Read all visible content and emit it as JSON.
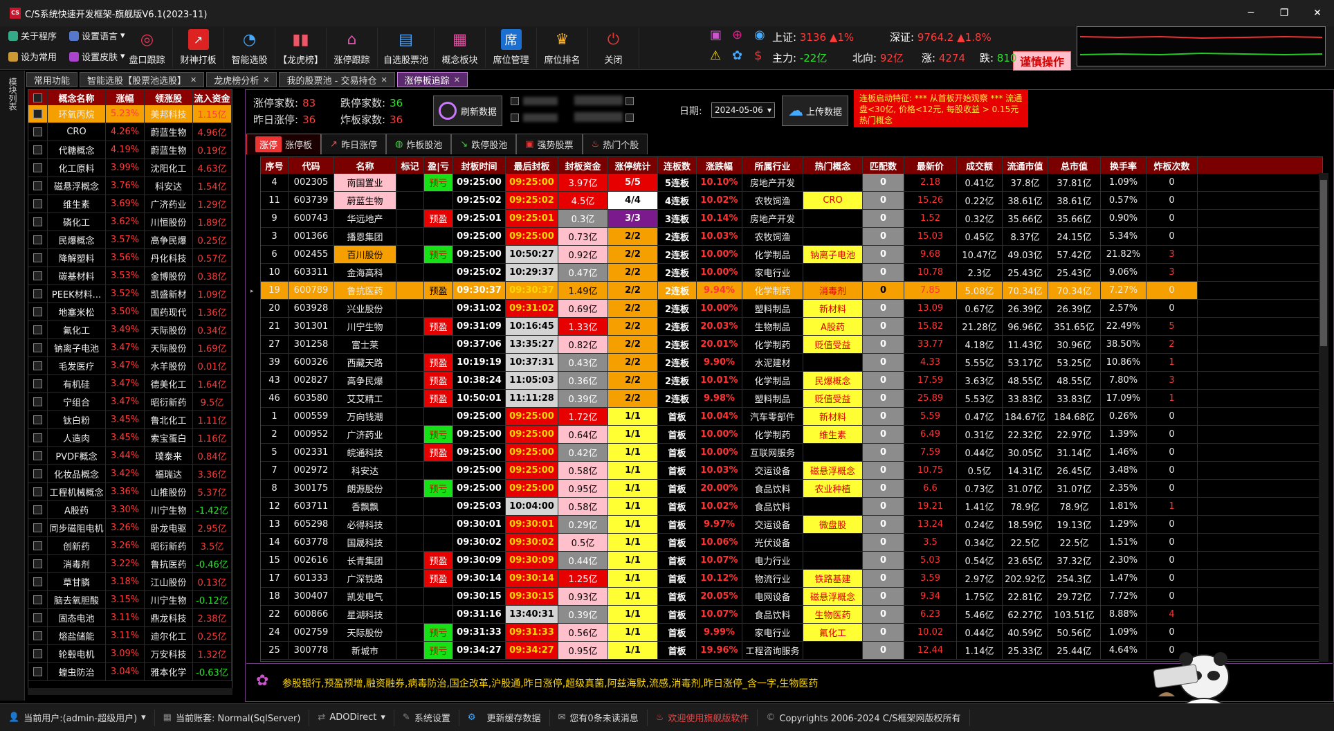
{
  "app": {
    "title": "C/S系统快速开发框架-旗舰版V6.1(2023-11)",
    "logo": "CS"
  },
  "toolbar": {
    "small": [
      "关于程序",
      "设置语言",
      "设为常用",
      "设置皮肤"
    ],
    "buttons": [
      "盘口跟踪",
      "财神打板",
      "智能选股",
      "【龙虎榜】",
      "涨停跟踪",
      "自选股票池",
      "概念板块",
      "席位管理",
      "席位排名",
      "关闭"
    ]
  },
  "market": {
    "sh_label": "上证:",
    "sh_value": "3136",
    "sh_change": "▲1%",
    "sz_label": "深证:",
    "sz_value": "9764.2",
    "sz_change": "▲1.8%",
    "main_label": "主力:",
    "main_value": "-22亿",
    "north_label": "北向:",
    "north_value": "92亿",
    "up_label": "涨:",
    "up_value": "4274",
    "down_label": "跌:",
    "down_value": "810",
    "warn": "谨慎操作"
  },
  "side_label": "模块列表",
  "tabs": [
    {
      "label": "常用功能"
    },
    {
      "label": "智能选股【股票池选股】"
    },
    {
      "label": "龙虎榜分析"
    },
    {
      "label": "我的股票池 - 交易持仓"
    },
    {
      "label": "涨停板追踪"
    }
  ],
  "left": {
    "headers": [
      "概念名称",
      "涨幅",
      "领涨股",
      "流入资金"
    ],
    "rows": [
      [
        "环氧丙烷",
        "5.23%",
        "美邦科技",
        "1.15亿"
      ],
      [
        "CRO",
        "4.26%",
        "蔚蓝生物",
        "4.96亿"
      ],
      [
        "代糖概念",
        "4.19%",
        "蔚蓝生物",
        "0.19亿"
      ],
      [
        "化工原料",
        "3.99%",
        "沈阳化工",
        "4.63亿"
      ],
      [
        "磁悬浮概念",
        "3.76%",
        "科安达",
        "1.54亿"
      ],
      [
        "维生素",
        "3.69%",
        "广济药业",
        "1.29亿"
      ],
      [
        "磷化工",
        "3.62%",
        "川恒股份",
        "1.89亿"
      ],
      [
        "民爆概念",
        "3.57%",
        "高争民爆",
        "0.25亿"
      ],
      [
        "降解塑料",
        "3.56%",
        "丹化科技",
        "0.57亿"
      ],
      [
        "碳基材料",
        "3.53%",
        "金博股份",
        "0.38亿"
      ],
      [
        "PEEK材料...",
        "3.52%",
        "凯盛新材",
        "1.09亿"
      ],
      [
        "地塞米松",
        "3.50%",
        "国药现代",
        "1.36亿"
      ],
      [
        "氟化工",
        "3.49%",
        "天际股份",
        "0.34亿"
      ],
      [
        "钠离子电池",
        "3.47%",
        "天际股份",
        "1.69亿"
      ],
      [
        "毛发医疗",
        "3.47%",
        "水羊股份",
        "0.01亿"
      ],
      [
        "有机硅",
        "3.47%",
        "德美化工",
        "1.64亿"
      ],
      [
        "宁组合",
        "3.47%",
        "昭衍新药",
        "9.5亿"
      ],
      [
        "钛白粉",
        "3.45%",
        "鲁北化工",
        "1.11亿"
      ],
      [
        "人造肉",
        "3.45%",
        "索宝蛋白",
        "1.16亿"
      ],
      [
        "PVDF概念",
        "3.44%",
        "璞泰来",
        "0.84亿"
      ],
      [
        "化妆品概念",
        "3.42%",
        "福瑞达",
        "3.36亿"
      ],
      [
        "工程机械概念",
        "3.36%",
        "山推股份",
        "5.37亿"
      ],
      [
        "A股药",
        "3.30%",
        "川宁生物",
        "-1.42亿"
      ],
      [
        "同步磁阻电机",
        "3.26%",
        "卧龙电驱",
        "2.95亿"
      ],
      [
        "创新药",
        "3.26%",
        "昭衍新药",
        "3.5亿"
      ],
      [
        "消毒剂",
        "3.22%",
        "鲁抗医药",
        "-0.46亿"
      ],
      [
        "草甘膦",
        "3.18%",
        "江山股份",
        "0.13亿"
      ],
      [
        "脑去氧胆酸",
        "3.15%",
        "川宁生物",
        "-0.12亿"
      ],
      [
        "固态电池",
        "3.11%",
        "鼎龙科技",
        "2.38亿"
      ],
      [
        "熔盐储能",
        "3.11%",
        "迪尔化工",
        "0.25亿"
      ],
      [
        "轮毂电机",
        "3.09%",
        "万安科技",
        "1.32亿"
      ],
      [
        "蝗虫防治",
        "3.04%",
        "雅本化学",
        "-0.63亿"
      ]
    ]
  },
  "stats": {
    "up_label": "涨停家数:",
    "up": "83",
    "down_label": "跌停家数:",
    "down": "36",
    "yday_label": "昨日涨停:",
    "yday": "36",
    "broken_label": "炸板家数:",
    "broken": "36"
  },
  "controls": {
    "refresh": "刷新数据",
    "date_label": "日期:",
    "date": "2024-05-06",
    "upload": "上传数据"
  },
  "notice": "连板启动特征: *** 从首板开始观察 *** 流通盘<30亿, 价格<12元, 每股收益 > 0.15元热门概念",
  "subtabs": [
    {
      "badge": "涨停",
      "label": "涨停板"
    },
    {
      "label": "昨日涨停"
    },
    {
      "label": "炸板股池"
    },
    {
      "label": "跌停股池"
    },
    {
      "label": "强势股票"
    },
    {
      "label": "热门个股"
    }
  ],
  "grid": {
    "headers": [
      "序号",
      "代码",
      "名称",
      "标记",
      "盈|亏",
      "封板时间",
      "最后封板",
      "封板资金",
      "涨停统计",
      "连板数",
      "涨跌幅",
      "所属行业",
      "热门概念",
      "匹配数",
      "最新价",
      "成交额",
      "流通市值",
      "总市值",
      "换手率",
      "炸板次数"
    ],
    "rows": [
      [
        "4",
        "002305",
        "南国置业",
        "",
        "预亏",
        "09:25:00",
        "09:25:00",
        "3.97亿",
        "5/5",
        "5连板",
        "10.10%",
        "房地产开发",
        "",
        "0",
        "2.18",
        "0.41亿",
        "37.8亿",
        "37.81亿",
        "1.09%",
        "0"
      ],
      [
        "11",
        "603739",
        "蔚蓝生物",
        "",
        "",
        "09:25:02",
        "09:25:02",
        "4.5亿",
        "4/4",
        "4连板",
        "10.02%",
        "农牧饲渔",
        "CRO",
        "0",
        "15.26",
        "0.22亿",
        "38.61亿",
        "38.61亿",
        "0.57%",
        "0"
      ],
      [
        "9",
        "600743",
        "华远地产",
        "",
        "预盈",
        "09:25:01",
        "09:25:01",
        "0.3亿",
        "3/3",
        "3连板",
        "10.14%",
        "房地产开发",
        "",
        "0",
        "1.52",
        "0.32亿",
        "35.66亿",
        "35.66亿",
        "0.90%",
        "0"
      ],
      [
        "3",
        "001366",
        "播恩集团",
        "",
        "",
        "09:25:00",
        "09:25:00",
        "0.73亿",
        "2/2",
        "2连板",
        "10.03%",
        "农牧饲渔",
        "",
        "0",
        "15.03",
        "0.45亿",
        "8.37亿",
        "24.15亿",
        "5.34%",
        "0"
      ],
      [
        "6",
        "002455",
        "百川股份",
        "",
        "预亏",
        "09:25:00",
        "10:50:27",
        "0.92亿",
        "2/2",
        "2连板",
        "10.00%",
        "化学制品",
        "钠离子电池",
        "0",
        "9.68",
        "10.47亿",
        "49.03亿",
        "57.42亿",
        "21.82%",
        "3"
      ],
      [
        "10",
        "603311",
        "金海高科",
        "",
        "",
        "09:25:02",
        "10:29:37",
        "0.47亿",
        "2/2",
        "2连板",
        "10.00%",
        "家电行业",
        "",
        "0",
        "10.78",
        "2.3亿",
        "25.43亿",
        "25.43亿",
        "9.06%",
        "3"
      ],
      [
        "19",
        "600789",
        "鲁抗医药",
        "",
        "预盈",
        "09:30:37",
        "09:30:37",
        "1.49亿",
        "2/2",
        "2连板",
        "9.94%",
        "化学制药",
        "消毒剂",
        "0",
        "7.85",
        "5.08亿",
        "70.34亿",
        "70.34亿",
        "7.27%",
        "0"
      ],
      [
        "20",
        "603928",
        "兴业股份",
        "",
        "",
        "09:31:02",
        "09:31:02",
        "0.69亿",
        "2/2",
        "2连板",
        "10.00%",
        "塑料制品",
        "新材料",
        "0",
        "13.09",
        "0.67亿",
        "26.39亿",
        "26.39亿",
        "2.57%",
        "0"
      ],
      [
        "21",
        "301301",
        "川宁生物",
        "",
        "预盈",
        "09:31:09",
        "10:16:45",
        "1.33亿",
        "2/2",
        "2连板",
        "20.03%",
        "生物制品",
        "A股药",
        "0",
        "15.82",
        "21.28亿",
        "96.96亿",
        "351.65亿",
        "22.49%",
        "5"
      ],
      [
        "27",
        "301258",
        "富士莱",
        "",
        "",
        "09:37:06",
        "13:35:27",
        "0.82亿",
        "2/2",
        "2连板",
        "20.01%",
        "化学制药",
        "贬值受益",
        "0",
        "33.77",
        "4.18亿",
        "11.43亿",
        "30.96亿",
        "38.50%",
        "2"
      ],
      [
        "39",
        "600326",
        "西藏天路",
        "",
        "预盈",
        "10:19:19",
        "10:37:31",
        "0.43亿",
        "2/2",
        "2连板",
        "9.90%",
        "水泥建材",
        "",
        "0",
        "4.33",
        "5.55亿",
        "53.17亿",
        "53.25亿",
        "10.86%",
        "1"
      ],
      [
        "43",
        "002827",
        "高争民爆",
        "",
        "预盈",
        "10:38:24",
        "11:05:03",
        "0.36亿",
        "2/2",
        "2连板",
        "10.01%",
        "化学制品",
        "民爆概念",
        "0",
        "17.59",
        "3.63亿",
        "48.55亿",
        "48.55亿",
        "7.80%",
        "3"
      ],
      [
        "46",
        "603580",
        "艾艾精工",
        "",
        "预盈",
        "10:50:01",
        "11:11:28",
        "0.39亿",
        "2/2",
        "2连板",
        "9.98%",
        "塑料制品",
        "贬值受益",
        "0",
        "25.89",
        "5.53亿",
        "33.83亿",
        "33.83亿",
        "17.09%",
        "1"
      ],
      [
        "1",
        "000559",
        "万向钱潮",
        "",
        "",
        "09:25:00",
        "09:25:00",
        "1.72亿",
        "1/1",
        "首板",
        "10.04%",
        "汽车零部件",
        "新材料",
        "0",
        "5.59",
        "0.47亿",
        "184.67亿",
        "184.68亿",
        "0.26%",
        "0"
      ],
      [
        "2",
        "000952",
        "广济药业",
        "",
        "预亏",
        "09:25:00",
        "09:25:00",
        "0.64亿",
        "1/1",
        "首板",
        "10.00%",
        "化学制药",
        "维生素",
        "0",
        "6.49",
        "0.31亿",
        "22.32亿",
        "22.97亿",
        "1.39%",
        "0"
      ],
      [
        "5",
        "002331",
        "皖通科技",
        "",
        "预盈",
        "09:25:00",
        "09:25:00",
        "0.42亿",
        "1/1",
        "首板",
        "10.00%",
        "互联网服务",
        "",
        "0",
        "7.59",
        "0.44亿",
        "30.05亿",
        "31.14亿",
        "1.46%",
        "0"
      ],
      [
        "7",
        "002972",
        "科安达",
        "",
        "",
        "09:25:00",
        "09:25:00",
        "0.58亿",
        "1/1",
        "首板",
        "10.03%",
        "交运设备",
        "磁悬浮概念",
        "0",
        "10.75",
        "0.5亿",
        "14.31亿",
        "26.45亿",
        "3.48%",
        "0"
      ],
      [
        "8",
        "300175",
        "朗源股份",
        "",
        "预亏",
        "09:25:00",
        "09:25:00",
        "0.95亿",
        "1/1",
        "首板",
        "20.00%",
        "食品饮料",
        "农业种植",
        "0",
        "6.6",
        "0.73亿",
        "31.07亿",
        "31.07亿",
        "2.35%",
        "0"
      ],
      [
        "12",
        "603711",
        "香飘飘",
        "",
        "",
        "09:25:03",
        "10:04:00",
        "0.58亿",
        "1/1",
        "首板",
        "10.02%",
        "食品饮料",
        "",
        "0",
        "19.21",
        "1.41亿",
        "78.9亿",
        "78.9亿",
        "1.81%",
        "1"
      ],
      [
        "13",
        "605298",
        "必得科技",
        "",
        "",
        "09:30:01",
        "09:30:01",
        "0.29亿",
        "1/1",
        "首板",
        "9.97%",
        "交运设备",
        "微盘股",
        "0",
        "13.24",
        "0.24亿",
        "18.59亿",
        "19.13亿",
        "1.29%",
        "0"
      ],
      [
        "14",
        "603778",
        "国晟科技",
        "",
        "",
        "09:30:02",
        "09:30:02",
        "0.5亿",
        "1/1",
        "首板",
        "10.06%",
        "光伏设备",
        "",
        "0",
        "3.5",
        "0.34亿",
        "22.5亿",
        "22.5亿",
        "1.51%",
        "0"
      ],
      [
        "15",
        "002616",
        "长青集团",
        "",
        "预盈",
        "09:30:09",
        "09:30:09",
        "0.44亿",
        "1/1",
        "首板",
        "10.07%",
        "电力行业",
        "",
        "0",
        "5.03",
        "0.54亿",
        "23.65亿",
        "37.32亿",
        "2.30%",
        "0"
      ],
      [
        "17",
        "601333",
        "广深铁路",
        "",
        "预盈",
        "09:30:14",
        "09:30:14",
        "1.25亿",
        "1/1",
        "首板",
        "10.12%",
        "物流行业",
        "铁路基建",
        "0",
        "3.59",
        "2.97亿",
        "202.92亿",
        "254.3亿",
        "1.47%",
        "0"
      ],
      [
        "18",
        "300407",
        "凯发电气",
        "",
        "",
        "09:30:15",
        "09:30:15",
        "0.93亿",
        "1/1",
        "首板",
        "20.05%",
        "电网设备",
        "磁悬浮概念",
        "0",
        "9.34",
        "1.75亿",
        "22.81亿",
        "29.72亿",
        "7.72%",
        "0"
      ],
      [
        "22",
        "600866",
        "星湖科技",
        "",
        "",
        "09:31:16",
        "13:40:31",
        "0.39亿",
        "1/1",
        "首板",
        "10.07%",
        "食品饮料",
        "生物医药",
        "0",
        "6.23",
        "5.46亿",
        "62.27亿",
        "103.51亿",
        "8.88%",
        "4"
      ],
      [
        "24",
        "002759",
        "天际股份",
        "",
        "预亏",
        "09:31:33",
        "09:31:33",
        "0.56亿",
        "1/1",
        "首板",
        "9.99%",
        "家电行业",
        "氟化工",
        "0",
        "10.02",
        "0.44亿",
        "40.59亿",
        "50.56亿",
        "1.09%",
        "0"
      ],
      [
        "25",
        "300778",
        "新城市",
        "",
        "预亏",
        "09:34:27",
        "09:34:27",
        "0.95亿",
        "1/1",
        "首板",
        "19.96%",
        "工程咨询服务",
        "",
        "0",
        "12.44",
        "1.14亿",
        "25.33亿",
        "25.44亿",
        "4.64%",
        "0"
      ]
    ]
  },
  "ticker": "参股银行,预盈预增,融资融券,病毒防治,国企改革,沪股通,昨日涨停,超级真菌,阿兹海默,流感,消毒剂,昨日涨停_含一字,生物医药",
  "status": [
    "当前用户:(admin-超级用户)",
    "当前账套: Normal(SqlServer)",
    "ADODirect",
    "系统设置",
    "更新缓存数据",
    "您有0条未读消息",
    "欢迎使用旗舰版软件",
    "Copyrights 2006-2024 C/S框架网版权所有"
  ],
  "colors": {
    "accent": "#c77be0",
    "header": "#7a0000",
    "limit_up": "#e60000",
    "highlight": "#f5a000"
  }
}
